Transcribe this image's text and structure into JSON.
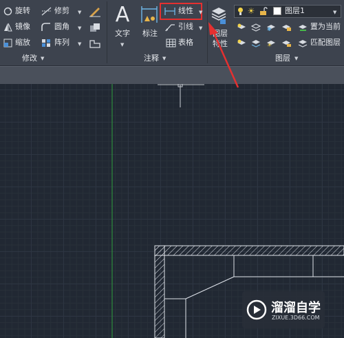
{
  "modify": {
    "rotate": "旋转",
    "mirror": "镜像",
    "scale": "缩放",
    "trim": "修剪",
    "fillet": "圆角",
    "array": "阵列",
    "group_label": "修改"
  },
  "annotation": {
    "text": "文字",
    "dimension": "标注",
    "linear": "线性",
    "leader": "引线",
    "table": "表格",
    "group_label": "注释"
  },
  "layers": {
    "properties_line1": "图层",
    "properties_line2": "特性",
    "current_layer": "图层1",
    "set_current": "置为当前",
    "match_layer": "匹配图层",
    "group_label": "图层"
  },
  "watermark": {
    "name": "溜溜自学",
    "url": "ZIXUE.3D66.COM"
  },
  "colors": {
    "highlight": "#e53030",
    "ribbon_bg": "#3d434e",
    "canvas_bg": "#212833",
    "axis_green": "#2e8b3e"
  }
}
